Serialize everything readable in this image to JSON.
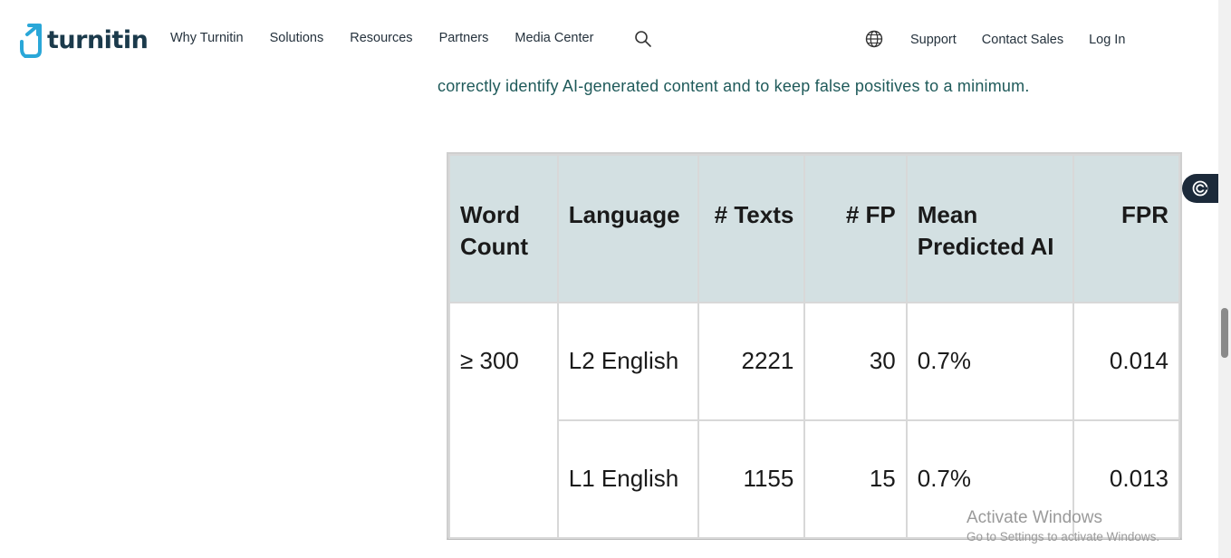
{
  "header": {
    "logo_text": "turnitin",
    "nav": [
      "Why Turnitin",
      "Solutions",
      "Resources",
      "Partners",
      "Media Center"
    ],
    "support": "Support",
    "contact_sales": "Contact Sales",
    "login": "Log In"
  },
  "intro": {
    "line2": "correctly identify AI-generated content and to keep false positives to a minimum."
  },
  "table": {
    "headers": {
      "word_count": "Word Count",
      "language": "Language",
      "texts": "# Texts",
      "fp": "# FP",
      "mean_predicted": "Mean Predicted AI",
      "fpr": "FPR"
    },
    "rows": [
      {
        "word_count": "≥ 300",
        "language": "L2 English",
        "texts": "2221",
        "fp": "30",
        "mean": "0.7%",
        "fpr": "0.014"
      },
      {
        "language": "L1 English",
        "texts": "1155",
        "fp": "15",
        "mean": "0.7%",
        "fpr": "0.013"
      }
    ]
  },
  "watermark": {
    "line1": "Activate Windows",
    "line2": "Go to Settings to activate Windows."
  },
  "colors": {
    "brand": "#1b3a4b",
    "accent": "#2aa7d8",
    "intro_text": "#1f5a5a",
    "table_header_bg": "#d3e0e2"
  },
  "icons": [
    "turnitin-logo-icon",
    "search-icon",
    "globe-icon",
    "side-widget-icon"
  ]
}
